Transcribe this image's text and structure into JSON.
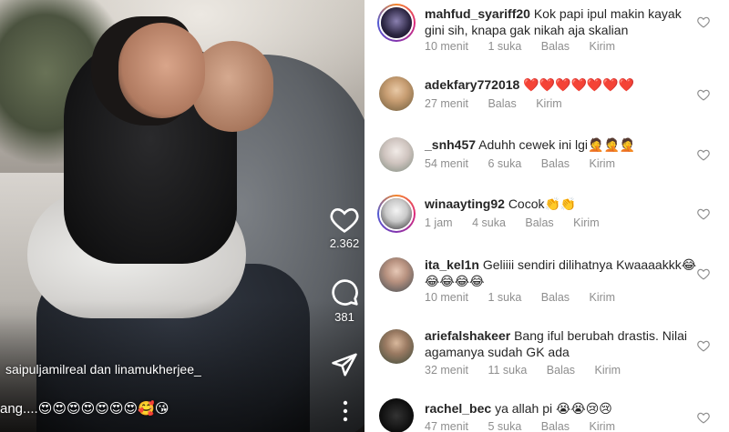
{
  "video": {
    "actions": {
      "likes": "2.362",
      "comments": "381"
    },
    "caption_user": "saipuljamilreal dan linamukherjee_",
    "caption_text": "ang....😍😍😍😍😍😍😍🥰😘"
  },
  "comment_actions": {
    "reply": "Balas",
    "send": "Kirim"
  },
  "comments": [
    {
      "username": "mahfud_syariff20",
      "text": "Kok papi ipul makin kayak gini sih, knapa gak nikah aja skalian",
      "time": "10 menit",
      "likes": "1 suka"
    },
    {
      "username": "adekfary772018",
      "text": "❤️❤️❤️❤️❤️❤️❤️",
      "time": "27 menit",
      "likes": ""
    },
    {
      "username": "_snh457",
      "text": "Aduhh cewek ini lgi🤦🤦🤦",
      "time": "54 menit",
      "likes": "6 suka"
    },
    {
      "username": "winaayting92",
      "text": "Cocok👏👏",
      "time": "1 jam",
      "likes": "4 suka"
    },
    {
      "username": "ita_kel1n",
      "text": "Geliiii sendiri dilihatnya Kwaaaakkk😂😂😂😂😂",
      "time": "10 menit",
      "likes": "1 suka"
    },
    {
      "username": "ariefalshakeer",
      "text": "Bang iful berubah drastis. Nilai agamanya sudah GK ada",
      "time": "32 menit",
      "likes": "11 suka"
    },
    {
      "username": "rachel_bec",
      "text": "ya allah pi 😭😭😢😢",
      "time": "47 menit",
      "likes": "5 suka"
    }
  ],
  "colors": {
    "text": "#262626",
    "muted": "#8e8e8e",
    "story_ring": "#dd2a7b"
  }
}
